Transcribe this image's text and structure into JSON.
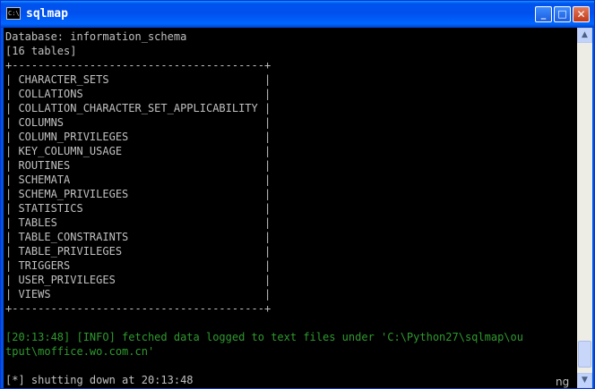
{
  "window": {
    "title": "sqlmap",
    "icon": "console-icon",
    "icon_text": "C:\\",
    "controls": {
      "minimize": "_",
      "maximize": "□",
      "close": "✕"
    }
  },
  "console": {
    "lines": [
      "Database: information_schema",
      "[16 tables]",
      "+---------------------------------------+",
      "| CHARACTER_SETS                        |",
      "| COLLATIONS                            |",
      "| COLLATION_CHARACTER_SET_APPLICABILITY |",
      "| COLUMNS                               |",
      "| COLUMN_PRIVILEGES                     |",
      "| KEY_COLUMN_USAGE                      |",
      "| ROUTINES                              |",
      "| SCHEMATA                              |",
      "| SCHEMA_PRIVILEGES                     |",
      "| STATISTICS                            |",
      "| TABLES                                |",
      "| TABLE_CONSTRAINTS                     |",
      "| TABLE_PRIVILEGES                      |",
      "| TRIGGERS                              |",
      "| USER_PRIVILEGES                       |",
      "| VIEWS                                 |",
      "+---------------------------------------+",
      "",
      "",
      "[20:13:48] [INFO] fetched data logged to text files under 'C:\\Python27\\sqlmap\\ou",
      "tput\\moffice.wo.com.cn'",
      "",
      "[*] shutting down at 20:13:48"
    ],
    "green_lines": [
      22,
      23
    ]
  },
  "watermark": "ng",
  "colors": {
    "console_bg": "#000000",
    "console_text": "#c0c0c0",
    "info_text": "#2f9a2f",
    "titlebar": "#0054e3"
  }
}
